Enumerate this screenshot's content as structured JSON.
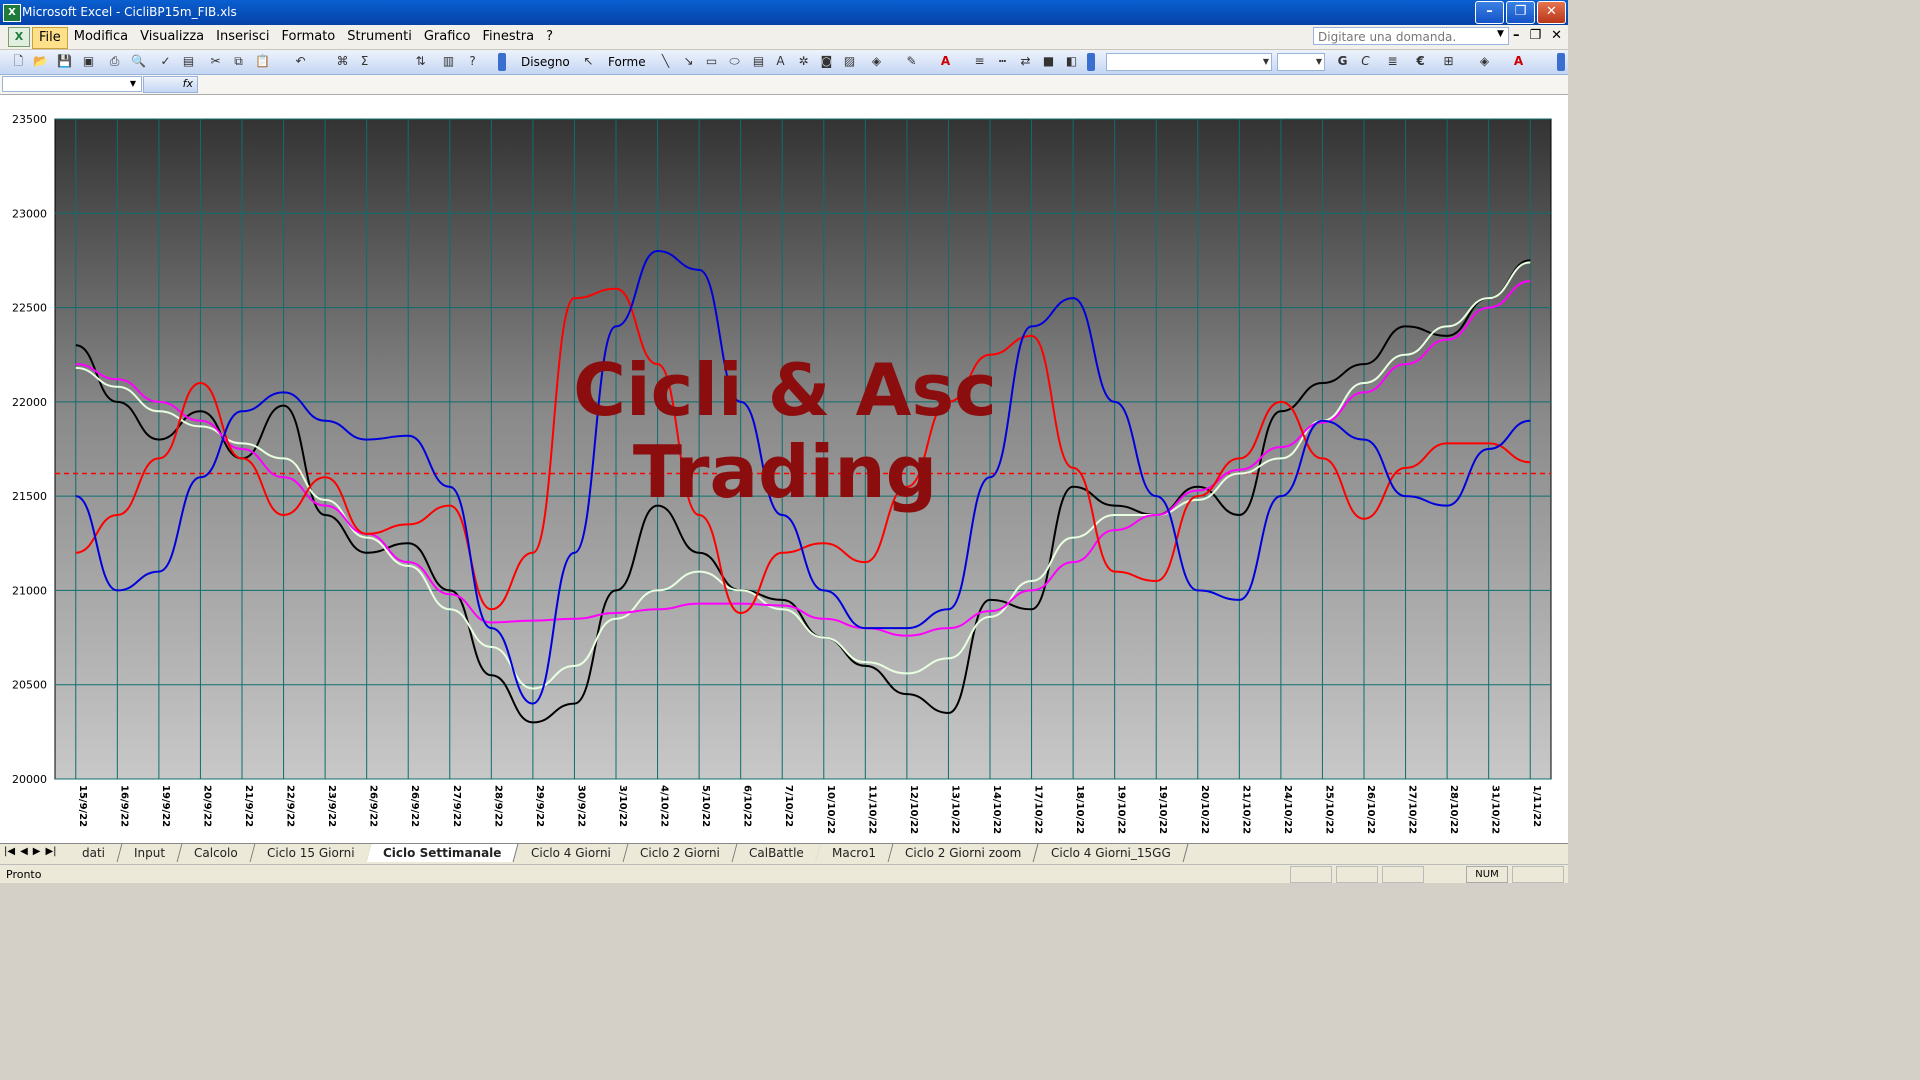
{
  "window": {
    "title": "Microsoft Excel - CicliBP15m_FIB.xls",
    "icon": "excel-icon"
  },
  "menu": {
    "items": [
      "File",
      "Modifica",
      "Visualizza",
      "Inserisci",
      "Formato",
      "Strumenti",
      "Grafico",
      "Finestra",
      "?"
    ],
    "active": "File",
    "ask_placeholder": "Digitare una domanda."
  },
  "toolbar": {
    "draw_label": "Disegno",
    "shapes_label": "Forme"
  },
  "chart": {
    "watermark_line1": "Cicli & Asc",
    "watermark_line2": "Trading",
    "colors": {
      "price": "#000000",
      "red_cycle": "#ff0000",
      "blue_cycle": "#0000dd",
      "magenta_avg": "#ff00ff",
      "white_avg": "#e8ffe0",
      "dotted_osc": "#2020cc",
      "ref_line": "#ff0000"
    }
  },
  "chart_data": {
    "type": "line",
    "title": "",
    "xlabel": "",
    "ylabel": "",
    "ylim": [
      20000,
      23500
    ],
    "yticks": [
      20000,
      20500,
      21000,
      21500,
      22000,
      22500,
      23000,
      23500
    ],
    "x": [
      "15/9/22",
      "16/9/22",
      "19/9/22",
      "20/9/22",
      "21/9/22",
      "22/9/22",
      "23/9/22",
      "26/9/22",
      "26/9/22",
      "27/9/22",
      "28/9/22",
      "29/9/22",
      "30/9/22",
      "3/10/22",
      "4/10/22",
      "5/10/22",
      "6/10/22",
      "7/10/22",
      "10/10/22",
      "11/10/22",
      "12/10/22",
      "13/10/22",
      "14/10/22",
      "17/10/22",
      "18/10/22",
      "19/10/22",
      "19/10/22",
      "20/10/22",
      "21/10/22",
      "24/10/22",
      "25/10/22",
      "26/10/22",
      "27/10/22",
      "28/10/22",
      "31/10/22",
      "1/11/22"
    ],
    "reference_line": 21620,
    "series": [
      {
        "values": [
          22300,
          22000,
          21800,
          21950,
          21700,
          21980,
          21400,
          21200,
          21250,
          21000,
          20550,
          20300,
          20400,
          21000,
          21450,
          21200,
          21000,
          20950,
          20750,
          20600,
          20450,
          20350,
          20950,
          20900,
          21550,
          21450,
          21400,
          21550,
          21400,
          21950,
          22100,
          22200,
          22400,
          22350,
          22550,
          22750
        ]
      },
      {
        "values": [
          22180,
          22080,
          21950,
          21870,
          21780,
          21700,
          21480,
          21280,
          21130,
          20900,
          20700,
          20480,
          20600,
          20850,
          21000,
          21100,
          21000,
          20900,
          20750,
          20620,
          20560,
          20640,
          20860,
          21050,
          21280,
          21400,
          21400,
          21480,
          21620,
          21700,
          21900,
          22100,
          22250,
          22400,
          22550,
          22740
        ]
      },
      {
        "values": [
          22200,
          22120,
          22000,
          21900,
          21750,
          21600,
          21450,
          21300,
          21150,
          20980,
          20830,
          20840,
          20850,
          20880,
          20900,
          20930,
          20930,
          20920,
          20850,
          20800,
          20760,
          20800,
          20890,
          21000,
          21150,
          21320,
          21400,
          21530,
          21640,
          21760,
          21890,
          22050,
          22200,
          22330,
          22500,
          22640
        ]
      },
      {
        "values": [
          21200,
          21400,
          21700,
          22100,
          21700,
          21400,
          21600,
          21300,
          21350,
          21450,
          20900,
          21200,
          22550,
          22600,
          22200,
          21400,
          20880,
          21200,
          21250,
          21150,
          21550,
          22000,
          22250,
          22350,
          21650,
          21100,
          21050,
          21500,
          21700,
          22000,
          21700,
          21380,
          21650,
          21780,
          21780,
          21680
        ]
      },
      {
        "values": [
          21500,
          21000,
          21100,
          21600,
          21950,
          22050,
          21900,
          21800,
          21820,
          21550,
          20800,
          20400,
          21200,
          22400,
          22800,
          22700,
          22000,
          21400,
          21000,
          20800,
          20800,
          20900,
          21600,
          22400,
          22550,
          22000,
          21500,
          21000,
          20950,
          21500,
          21900,
          21800,
          21500,
          21450,
          21750,
          21900
        ]
      }
    ]
  },
  "sheet_tabs": [
    "dati",
    "Input",
    "Calcolo",
    "Ciclo 15 Giorni",
    "Ciclo Settimanale",
    "Ciclo 4 Giorni",
    "Ciclo 2 Giorni",
    "CalBattle",
    "Macro1",
    "Ciclo 2 Giorni zoom",
    "Ciclo 4 Giorni_15GG"
  ],
  "active_tab": "Ciclo Settimanale",
  "status": {
    "text": "Pronto",
    "num": "NUM"
  }
}
